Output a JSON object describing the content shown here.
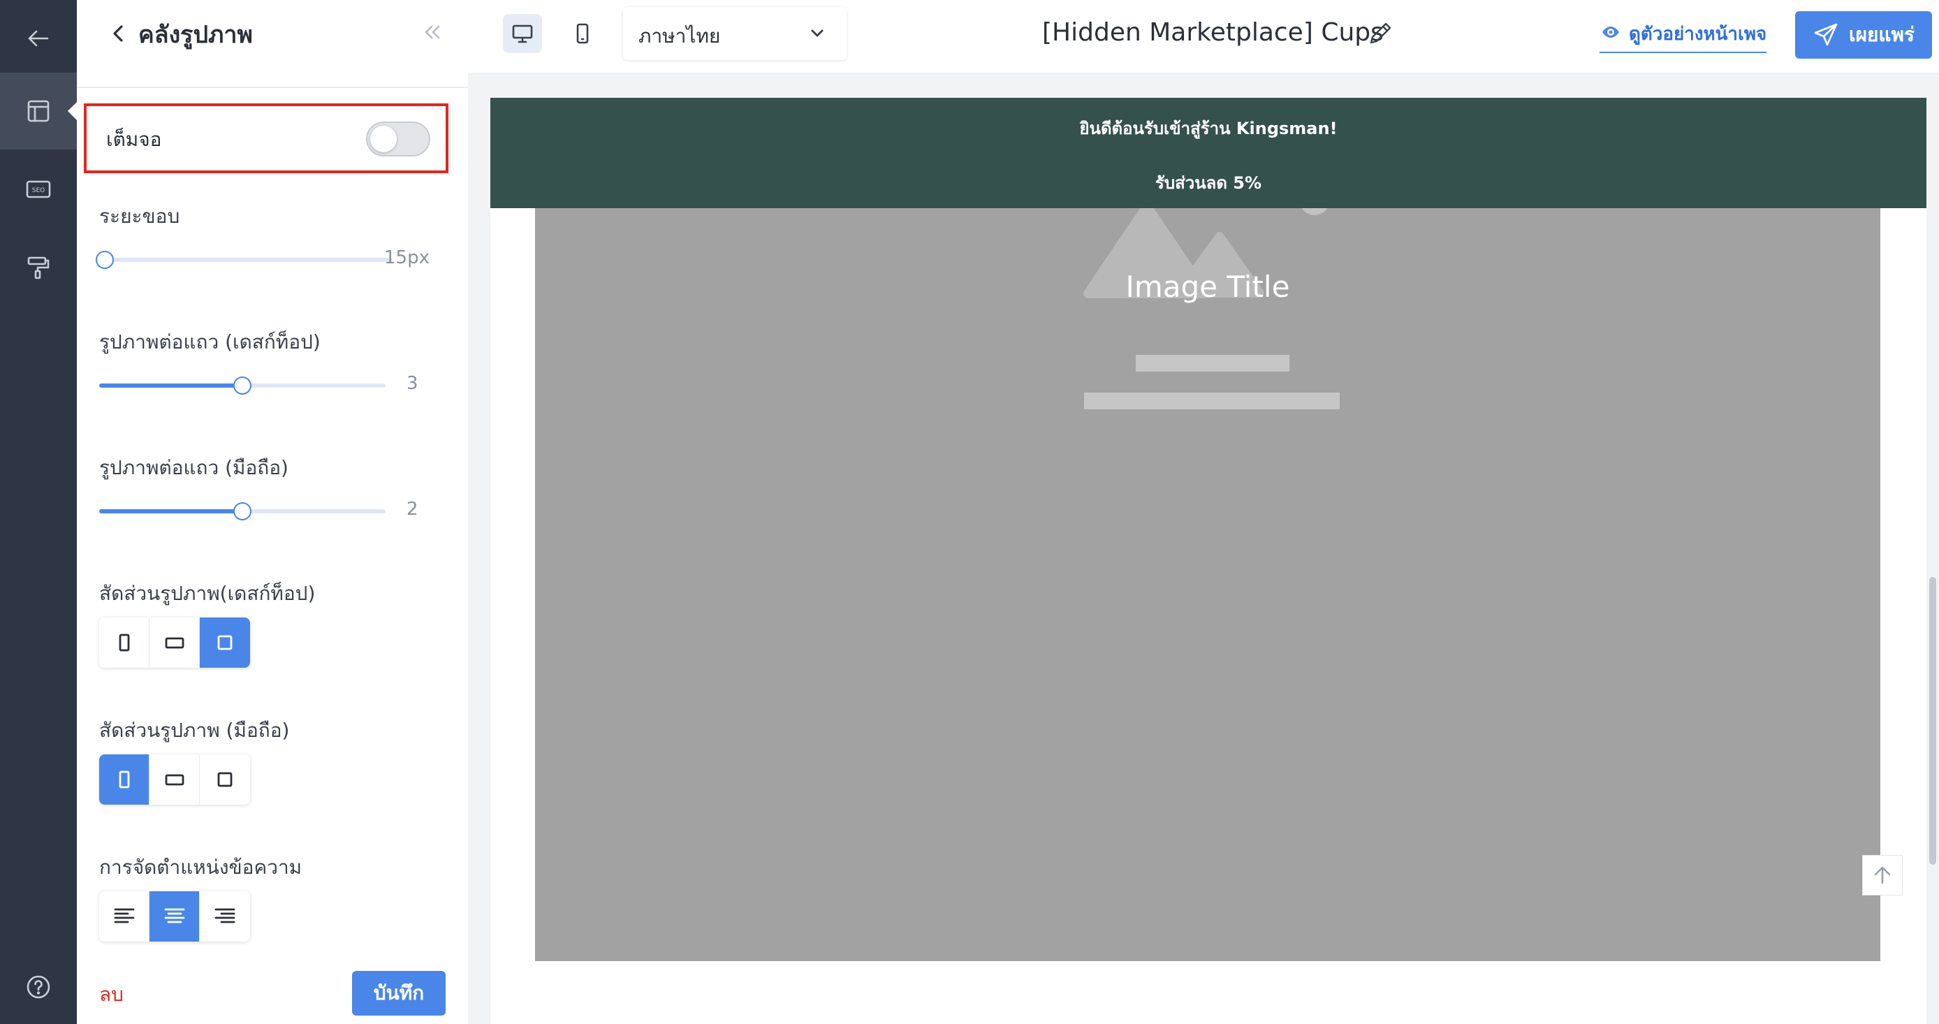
{
  "panel": {
    "title": "คลังรูปภาพ",
    "fullscreen_label": "เต็มจอ",
    "fullscreen_on": false,
    "padding": {
      "label": "ระยะขอบ",
      "value_text": "15px",
      "fraction": 0.0
    },
    "per_row_desktop": {
      "label": "รูปภาพต่อแถว (เดสก์ท็อป)",
      "value_text": "3",
      "fraction": 0.5
    },
    "per_row_mobile": {
      "label": "รูปภาพต่อแถว (มือถือ)",
      "value_text": "2",
      "fraction": 0.5
    },
    "ratio_desktop": {
      "label": "สัดส่วนรูปภาพ(เดสก์ท็อป)",
      "options": [
        "portrait-icon",
        "landscape-icon",
        "square-icon"
      ],
      "selected": 2
    },
    "ratio_mobile": {
      "label": "สัดส่วนรูปภาพ (มือถือ)",
      "options": [
        "portrait-icon",
        "landscape-icon",
        "square-icon"
      ],
      "selected": 0
    },
    "text_align": {
      "label": "การจัดตำแหน่งข้อความ",
      "options": [
        "align-left-icon",
        "align-center-icon",
        "align-right-icon"
      ],
      "selected": 1
    },
    "delete_label": "ลบ",
    "save_label": "บันทึก"
  },
  "rail": {
    "icons": [
      "back-arrow-icon",
      "layout-icon",
      "seo-icon",
      "paint-roller-icon",
      "help-icon"
    ],
    "active": 1,
    "seo_text": "SEO"
  },
  "topbar": {
    "devices": [
      "desktop-icon",
      "mobile-icon"
    ],
    "selected_device": "desktop",
    "language": "ภาษาไทย",
    "page_name": "[Hidden Marketplace] Cups",
    "preview_label": "ดูตัวอย่างหน้าเพจ",
    "publish_label": "เผยแพร่"
  },
  "canvas": {
    "announcement_line1": "ยินดีต้อนรับเข้าสู่ร้าน Kingsman!",
    "announcement_line2": "รับส่วนลด 5%",
    "image_title": "Image Title"
  },
  "colors": {
    "accent": "#4a86e8",
    "rail": "#2f3544",
    "announcement_bg": "#34514b",
    "highlight_border": "#e0281e",
    "placeholder": "#a2a2a2"
  }
}
